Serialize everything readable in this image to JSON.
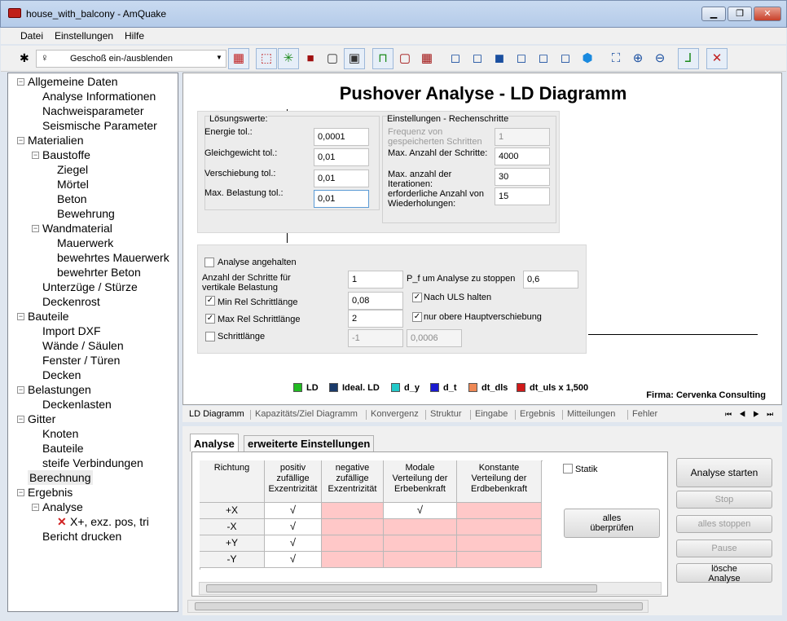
{
  "window": {
    "title": "house_with_balcony - AmQuake"
  },
  "menu": [
    "Datei",
    "Einstellungen",
    "Hilfe"
  ],
  "toolbar": {
    "floor_select": "Geschoß ein-/ausblenden"
  },
  "tree": [
    {
      "label": "Allgemeine Daten",
      "level": 0,
      "toggle": "−"
    },
    {
      "label": "Analyse Informationen",
      "level": 1
    },
    {
      "label": "Nachweisparameter",
      "level": 1
    },
    {
      "label": "Seismische Parameter",
      "level": 1
    },
    {
      "label": "Materialien",
      "level": 0,
      "toggle": "−"
    },
    {
      "label": "Baustoffe",
      "level": 1,
      "toggle": "−"
    },
    {
      "label": "Ziegel",
      "level": 2
    },
    {
      "label": "Mörtel",
      "level": 2
    },
    {
      "label": "Beton",
      "level": 2
    },
    {
      "label": "Bewehrung",
      "level": 2
    },
    {
      "label": "Wandmaterial",
      "level": 1,
      "toggle": "−"
    },
    {
      "label": "Mauerwerk",
      "level": 2
    },
    {
      "label": "bewehrtes Mauerwerk",
      "level": 2
    },
    {
      "label": "bewehrter Beton",
      "level": 2
    },
    {
      "label": "Unterzüge / Stürze",
      "level": 1
    },
    {
      "label": "Deckenrost",
      "level": 1
    },
    {
      "label": "Bauteile",
      "level": 0,
      "toggle": "−"
    },
    {
      "label": "Import DXF",
      "level": 1
    },
    {
      "label": "Wände / Säulen",
      "level": 1
    },
    {
      "label": "Fenster / Türen",
      "level": 1
    },
    {
      "label": "Decken",
      "level": 1
    },
    {
      "label": "Belastungen",
      "level": 0,
      "toggle": "−"
    },
    {
      "label": "Deckenlasten",
      "level": 1
    },
    {
      "label": "Gitter",
      "level": 0,
      "toggle": "−"
    },
    {
      "label": "Knoten",
      "level": 1
    },
    {
      "label": "Bauteile",
      "level": 1
    },
    {
      "label": "steife Verbindungen",
      "level": 1
    },
    {
      "label": "Berechnung",
      "level": 0,
      "selected": true
    },
    {
      "label": "Ergebnis",
      "level": 0,
      "toggle": "−"
    },
    {
      "label": "Analyse",
      "level": 1,
      "toggle": "−"
    },
    {
      "label": "X+, exz. pos, tri",
      "level": 2,
      "error": true
    },
    {
      "label": "Bericht drucken",
      "level": 1
    }
  ],
  "main": {
    "title": "Pushover Analyse - LD Diagramm",
    "loesung": {
      "title": "Lösungswerte:",
      "fields": [
        {
          "label": "Energie tol.:",
          "value": "0,0001"
        },
        {
          "label": "Gleichgewicht tol.:",
          "value": "0,01"
        },
        {
          "label": "Verschiebung tol.:",
          "value": "0,01"
        },
        {
          "label": "Max. Belastung tol.:",
          "value": "0,01"
        }
      ]
    },
    "rechen": {
      "title": "Einstellungen - Rechenschritte",
      "freq_label": "Frequenz von gespeicherten Schritten",
      "freq_value": "1",
      "max_steps_label": "Max. Anzahl der Schritte:",
      "max_steps_value": "4000",
      "max_iter_label": "Max.  anzahl der Iterationen:",
      "max_iter_value": "30",
      "wdh_label": "erforderliche Anzahl von Wiederholungen:",
      "wdh_value": "15"
    },
    "steps": {
      "analyse_halt": "Analyse angehalten",
      "anzahl_label": "Anzahl der Schritte für vertikale Belastung",
      "anzahl_value": "1",
      "pf_label": "P_f um Analyse zu stoppen",
      "pf_value": "0,6",
      "min_label": "Min Rel Schrittlänge",
      "min_value": "0,08",
      "nach_uls": "Nach ULS halten",
      "max_label": "Max Rel Schrittlänge",
      "max_value": "2",
      "obere": "nur obere Hauptverschiebung",
      "schritt_label": "Schrittlänge",
      "schritt_value1": "-1",
      "schritt_value2": "0,0006"
    },
    "legend": [
      {
        "label": "LD",
        "color": "#22bb22"
      },
      {
        "label": "Ideal. LD",
        "color": "#1a3a6a"
      },
      {
        "label": "d_y",
        "color": "#22c8c8"
      },
      {
        "label": "d_t",
        "color": "#1a1ad0"
      },
      {
        "label": "dt_dls",
        "color": "#ee8855"
      },
      {
        "label": "dt_uls x 1,500",
        "color": "#d01a1a"
      }
    ],
    "firma": "Firma: Cervenka Consulting"
  },
  "bottom_tabs": [
    "LD Diagramm",
    "Kapazitäts/Ziel Diagramm",
    "Konvergenz",
    "Struktur",
    "Eingabe",
    "Ergebnis",
    "Mitteilungen",
    "Fehler"
  ],
  "lower": {
    "tabs": [
      "Analyse",
      "erweiterte Einstellungen"
    ],
    "headers": [
      "Richtung",
      "positiv zufällige Exzentrizität",
      "negative zufällige Exzentrizität",
      "Modale Verteilung der Erbebenkraft",
      "Konstante Verteilung der Erdbebenkraft"
    ],
    "rows": [
      {
        "dir": "+X",
        "c1": "√",
        "c2": "",
        "c3": "√",
        "c4": ""
      },
      {
        "dir": "-X",
        "c1": "√",
        "c2": "",
        "c3": "",
        "c4": ""
      },
      {
        "dir": "+Y",
        "c1": "√",
        "c2": "",
        "c3": "",
        "c4": ""
      },
      {
        "dir": "-Y",
        "c1": "√",
        "c2": "",
        "c3": "",
        "c4": ""
      }
    ],
    "statik": "Statik",
    "alles_ueberpruefen": "alles überprüfen",
    "buttons": {
      "start": "Analyse starten",
      "stop": "Stop",
      "alles_stoppen": "alles stoppen",
      "pause": "Pause",
      "loesche": "lösche Analyse"
    }
  }
}
